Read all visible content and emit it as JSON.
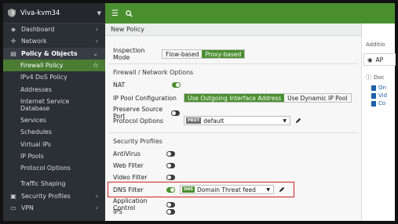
{
  "sidebar": {
    "device_name": "Viva-kvm34",
    "items": [
      {
        "label": "Dashboard",
        "icon": "dashboard-icon",
        "glyph": "◈",
        "chevron": "›"
      },
      {
        "label": "Network",
        "icon": "network-icon",
        "glyph": "✛",
        "chevron": "›"
      },
      {
        "label": "Policy & Objects",
        "icon": "policy-icon",
        "glyph": "▤",
        "chevron": "⌄"
      }
    ],
    "sub_items": [
      "Firewall Policy",
      "IPv4 DoS Policy",
      "Addresses",
      "Internet Service Database",
      "Services",
      "Schedules",
      "Virtual IPs",
      "IP Pools",
      "Protocol Options",
      "Traffic Shaping"
    ],
    "bottom_items": [
      {
        "label": "Security Profiles",
        "icon": "lock-icon",
        "glyph": "🔒",
        "chevron": "›"
      },
      {
        "label": "VPN",
        "icon": "monitor-icon",
        "glyph": "▭",
        "chevron": "›"
      }
    ]
  },
  "topbar": {
    "menu_glyph": "☰"
  },
  "page": {
    "title": "New Policy",
    "inspection_mode_label": "Inspection Mode",
    "inspection_options": [
      "Flow-based",
      "Proxy-based"
    ],
    "inspection_selected": "Proxy-based",
    "fw_section_title": "Firewall / Network Options",
    "nat_label": "NAT",
    "nat_on": true,
    "ip_pool_label": "IP Pool Configuration",
    "ip_pool_options": [
      "Use Outgoing Interface Address",
      "Use Dynamic IP Pool"
    ],
    "ip_pool_selected": "Use Outgoing Interface Address",
    "preserve_label": "Preserve Source Port",
    "preserve_on": false,
    "protocol_label": "Protocol Options",
    "protocol_badge": "PROT",
    "protocol_value": "default",
    "sec_section_title": "Security Profiles",
    "antivirus_label": "AntiVirus",
    "webfilter_label": "Web Filter",
    "videofilter_label": "Video Filter",
    "dnsfilter_label": "DNS Filter",
    "dns_badge": "DNS",
    "dns_value": "Domain Threat feed",
    "appcontrol_label": "Application Control",
    "ips_label": "IPS"
  },
  "right_panel": {
    "additional_label": "Additio",
    "api_label": "AP",
    "doc_label": "Doc",
    "links": [
      "On",
      "Vid",
      "Co"
    ]
  },
  "colors": {
    "accent": "#4a8f2f",
    "highlight": "#d21f1f",
    "sidebar_bg": "#2b2f36"
  }
}
